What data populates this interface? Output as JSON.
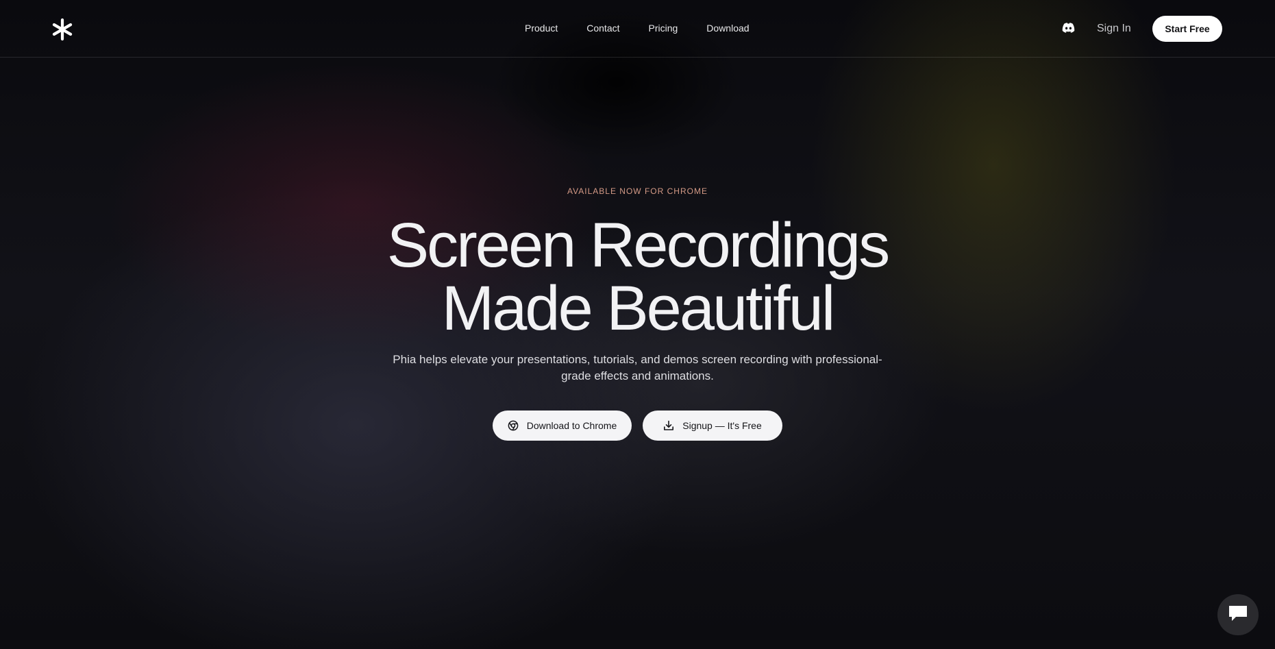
{
  "header": {
    "logo_icon": "asterisk-logo-icon",
    "nav": [
      {
        "label": "Product"
      },
      {
        "label": "Contact"
      },
      {
        "label": "Pricing"
      },
      {
        "label": "Download"
      }
    ],
    "discord_icon": "discord-icon",
    "sign_in_label": "Sign In",
    "start_free_label": "Start Free"
  },
  "hero": {
    "eyebrow": "AVAILABLE NOW FOR CHROME",
    "headline_line1": "Screen Recordings",
    "headline_line2": "Made Beautiful",
    "subtitle": "Phia helps elevate your presentations, tutorials, and demos screen recording with professional-grade effects and animations.",
    "cta_primary_label": "Download to Chrome",
    "cta_primary_icon": "chrome-icon",
    "cta_secondary_label": "Signup — It's Free",
    "cta_secondary_icon": "download-icon"
  },
  "chat": {
    "icon": "chat-bubble-icon"
  },
  "colors": {
    "background": "#09090c",
    "eyebrow": "#d49a86",
    "button_bg": "#ffffff",
    "button_text": "#111114"
  }
}
